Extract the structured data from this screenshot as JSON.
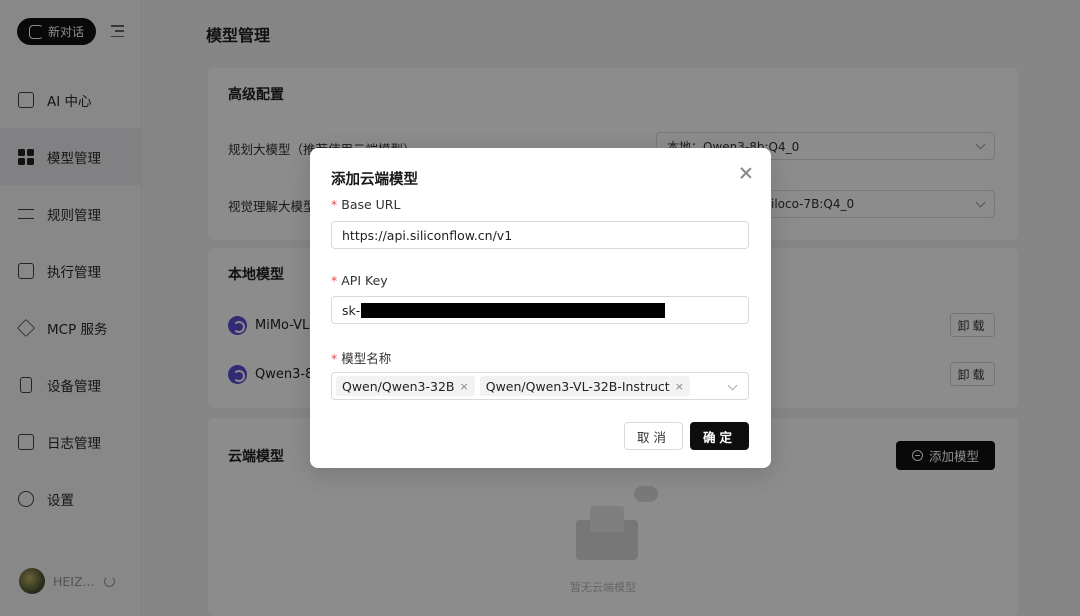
{
  "sidebar": {
    "new_chat_label": "新对话",
    "items": [
      {
        "label": "AI 中心",
        "icon": "chat-icon",
        "active": false
      },
      {
        "label": "模型管理",
        "icon": "grid-icon",
        "active": true
      },
      {
        "label": "规则管理",
        "icon": "sliders-icon",
        "active": false
      },
      {
        "label": "执行管理",
        "icon": "edit-icon",
        "active": false
      },
      {
        "label": "MCP 服务",
        "icon": "layers-icon",
        "active": false
      },
      {
        "label": "设备管理",
        "icon": "device-icon",
        "active": false
      },
      {
        "label": "日志管理",
        "icon": "calendar-icon",
        "active": false
      },
      {
        "label": "设置",
        "icon": "gear-icon",
        "active": false
      }
    ],
    "user_name": "HEIZ..."
  },
  "main": {
    "page_title": "模型管理",
    "advanced": {
      "title": "高级配置",
      "planning_label": "规划大模型（推荐使用云端模型）",
      "planning_value": "本地：Qwen3-8b:Q4_0",
      "vision_label": "视觉理解大模型",
      "vision_value": "iloco-7B:Q4_0"
    },
    "local": {
      "title": "本地模型",
      "models": [
        {
          "name": "MiMo-VL-",
          "action": "卸载"
        },
        {
          "name": "Qwen3-8",
          "action": "卸载"
        }
      ]
    },
    "cloud": {
      "title": "云端模型",
      "add_button": "添加模型",
      "empty_text": "暂无云端模型"
    }
  },
  "modal": {
    "title": "添加云端模型",
    "base_url_label": "Base URL",
    "base_url_value": "https://api.siliconflow.cn/v1",
    "api_key_label": "API Key",
    "api_key_prefix": "sk-",
    "model_name_label": "模型名称",
    "model_tags": [
      "Qwen/Qwen3-32B",
      "Qwen/Qwen3-VL-32B-Instruct"
    ],
    "cancel_label": "取消",
    "ok_label": "确定"
  }
}
